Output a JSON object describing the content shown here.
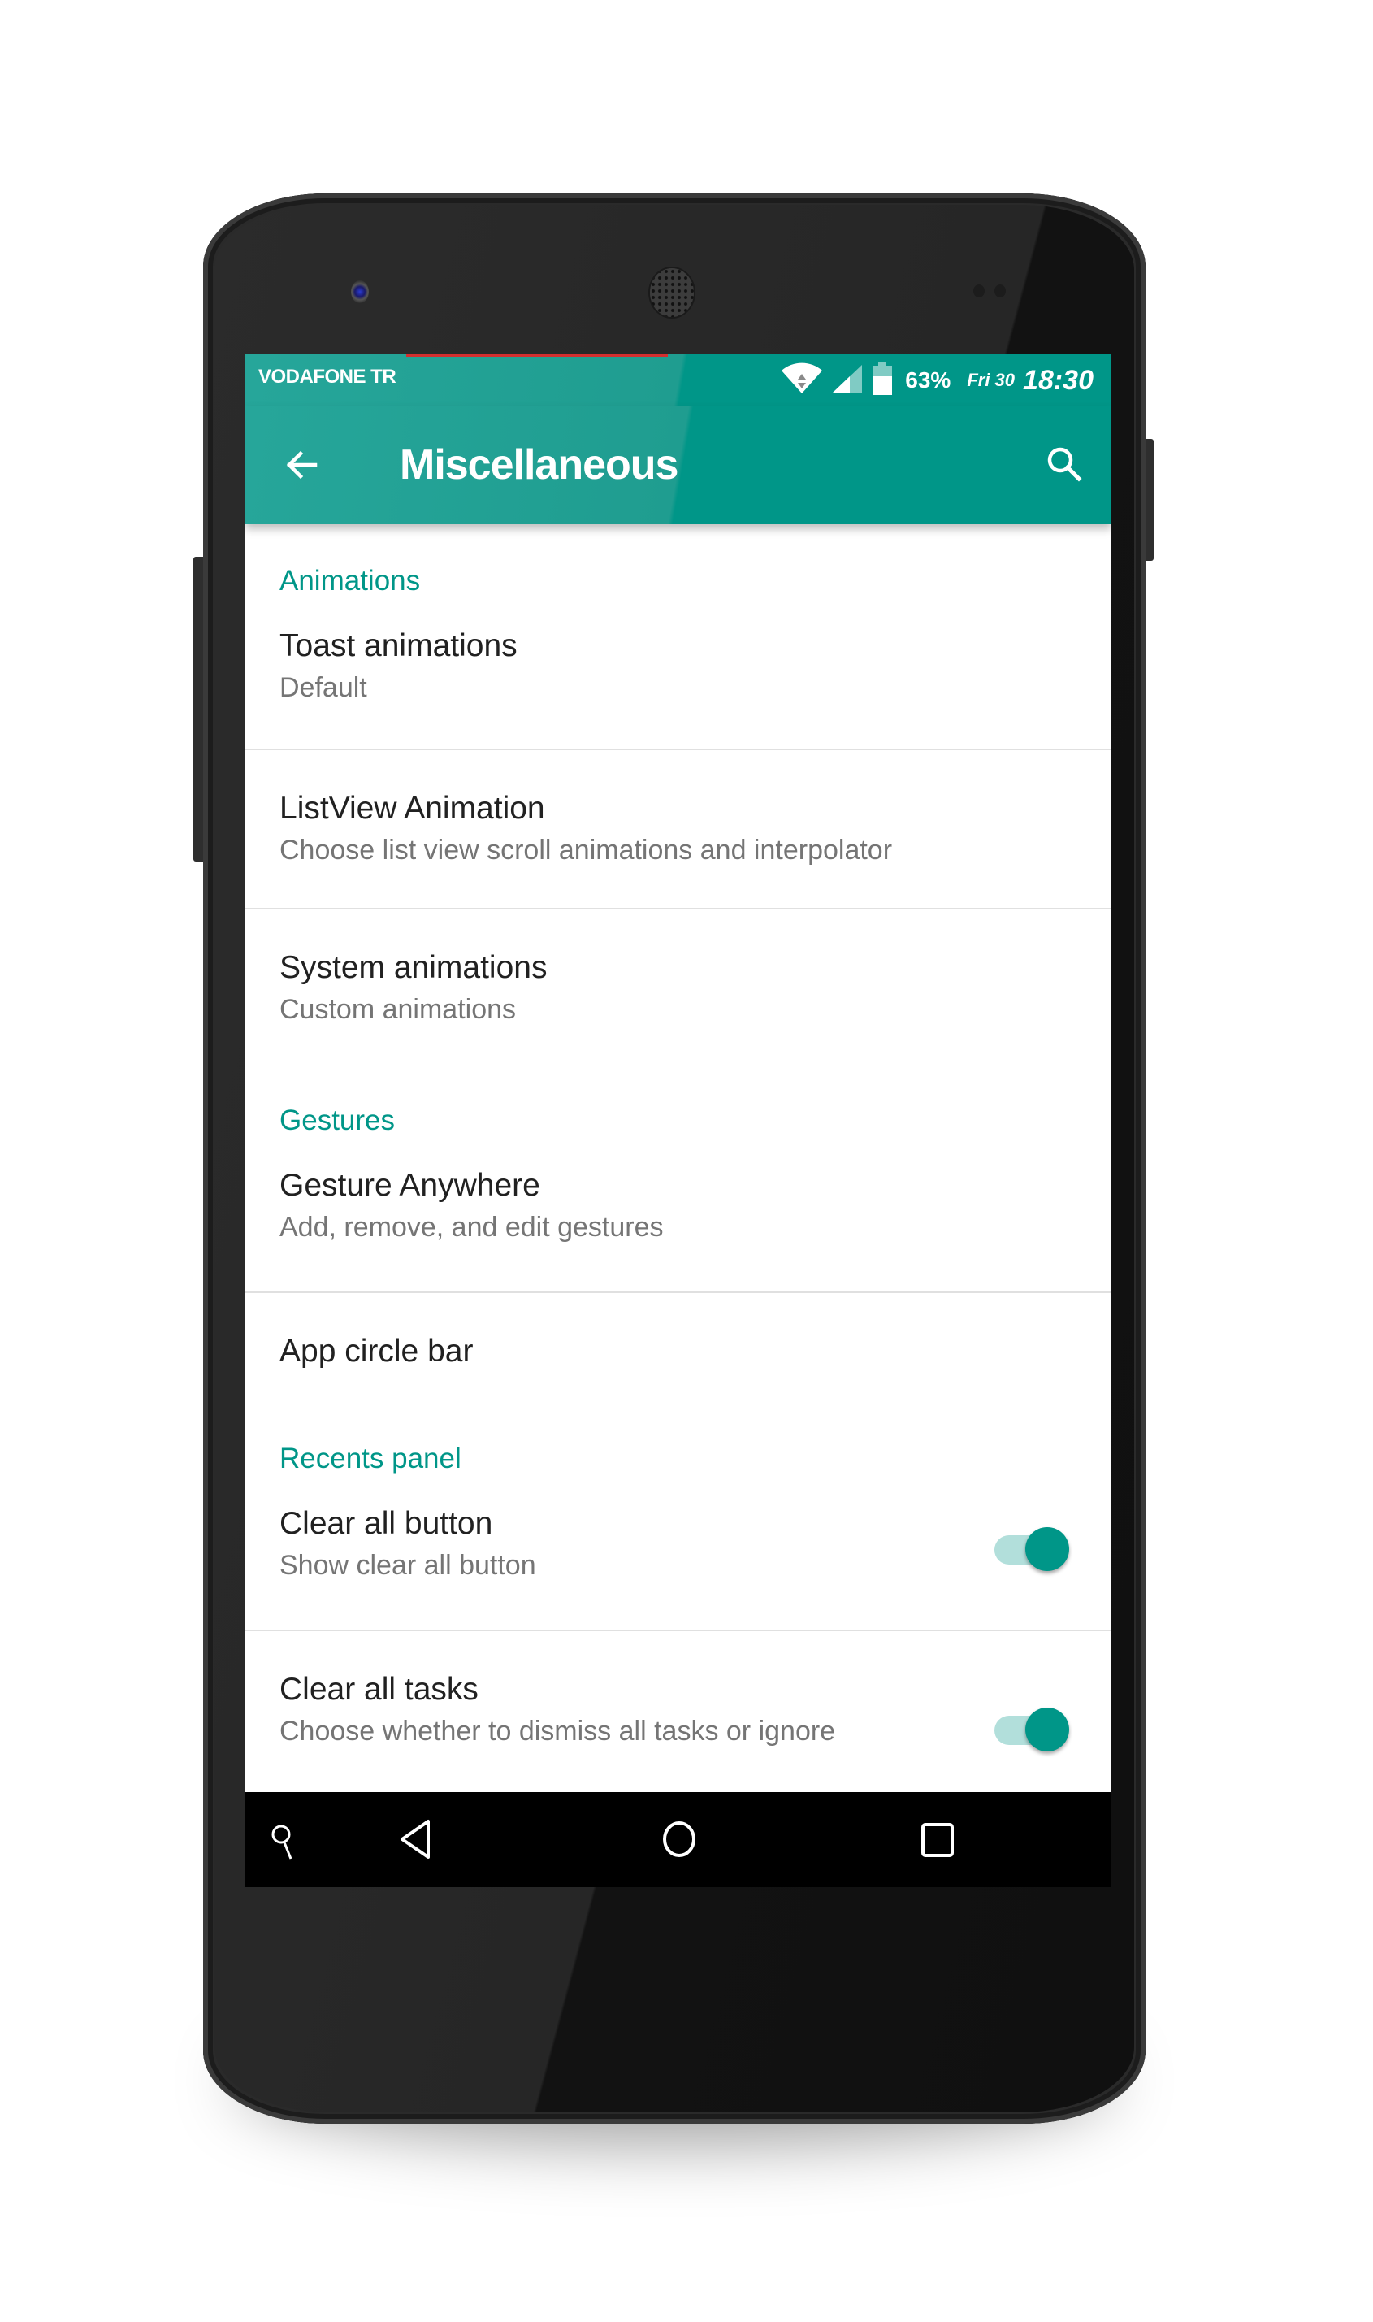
{
  "status_bar": {
    "carrier": "VODAFONE TR",
    "battery_percent": "63%",
    "battery_level": 0.63,
    "date": "Fri 30",
    "time": "18:30",
    "icons": [
      "wifi-icon",
      "cellular-signal-icon",
      "battery-icon"
    ]
  },
  "app_bar": {
    "title": "Miscellaneous",
    "back_icon": "arrow-back-icon",
    "search_icon": "search-icon"
  },
  "sections": [
    {
      "header": "Animations",
      "items": [
        {
          "title": "Toast animations",
          "summary": "Default"
        },
        {
          "title": "ListView Animation",
          "summary": "Choose list view scroll animations and interpolator"
        },
        {
          "title": "System animations",
          "summary": "Custom animations"
        }
      ]
    },
    {
      "header": "Gestures",
      "items": [
        {
          "title": "Gesture Anywhere",
          "summary": "Add, remove, and edit gestures"
        },
        {
          "title": "App circle bar",
          "summary": ""
        }
      ]
    },
    {
      "header": "Recents panel",
      "items": [
        {
          "title": "Clear all button",
          "summary": "Show clear all button",
          "switch_on": true
        },
        {
          "title": "Clear all tasks",
          "summary": "Choose whether to dismiss all tasks or ignore",
          "switch_on": true
        }
      ]
    }
  ],
  "nav_bar": {
    "icons": [
      "search-icon",
      "back-triangle-icon",
      "home-circle-icon",
      "recents-square-icon"
    ]
  },
  "colors": {
    "accent": "#009688",
    "accent_light": "#b2dfdb",
    "title_text": "#212121",
    "summary_text": "#757575",
    "notification_led": "#d32f2f"
  }
}
